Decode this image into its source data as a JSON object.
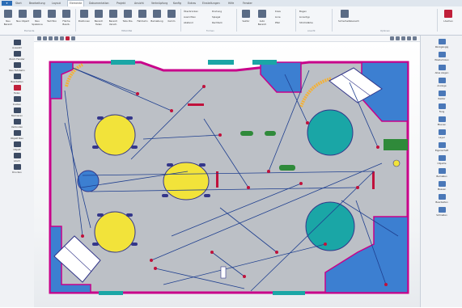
{
  "menubar": {
    "file_label": "",
    "tabs": [
      "Start",
      "Bearbeitung",
      "Layout",
      "Elemente",
      "Dokumentation",
      "Projekt",
      "Ansicht",
      "Verknüpfung",
      "Konfig",
      "Extras",
      "Einstellungen",
      "Hilfe",
      "Fenster"
    ],
    "active_tab": "Elemente"
  },
  "ribbon": {
    "buttons": [
      "Neu Bereich",
      "Neu Objekt",
      "Neu Spielzone",
      "Text Box",
      "Fläche Bearb.",
      "Positionen",
      "Bereich Teilen",
      "Bereich Versch.",
      "Teile Pos.",
      "Fahrbahn",
      "Bemaßung",
      "Kamm",
      "Sektor",
      "Auto Bereich",
      "Sicherheitsbereich",
      "Löschen"
    ],
    "small_items": [
      "Überbrücken",
      "Ausrichten",
      "Abstand",
      "Drehung",
      "Spiegel",
      "Rechteck",
      "Kreis",
      "Linie",
      "Pfeil",
      "Bogen",
      "Linientyp",
      "Strichstärke"
    ],
    "groups": [
      "Elemente",
      "Hilfsmittel",
      "Formen",
      "Ansicht",
      "Optionen"
    ]
  },
  "left_toolbar": {
    "items": [
      "Auswahl",
      "Zoom Fenster",
      "Neu Fahrbahn",
      "Bearbeiten",
      "Teilen",
      "Knoten",
      "Markieren",
      "Verbinden",
      "Objekt Neu",
      "Objekt",
      "Lösch",
      "Drucken"
    ]
  },
  "right_toolbar": {
    "items": [
      "Rückgängig",
      "Wiederholen",
      "Alles zeigen",
      "Anzeige",
      "Raster",
      "Fang",
      "Ebenen",
      "Layer",
      "Eigenschaft",
      "Objekte",
      "Bemaßen",
      "Messen",
      "Bearbeiten",
      "Schließen"
    ]
  },
  "plan": {
    "colors": {
      "floor": "#bcc0c6",
      "wall": "#c8008a",
      "zone": "#3c7fd1",
      "yellow": "#f2e33a",
      "teal": "#1aa6a6",
      "navy": "#33368a",
      "green": "#2f8a3a",
      "red": "#c0113b",
      "line": "#1f3f8f"
    }
  }
}
